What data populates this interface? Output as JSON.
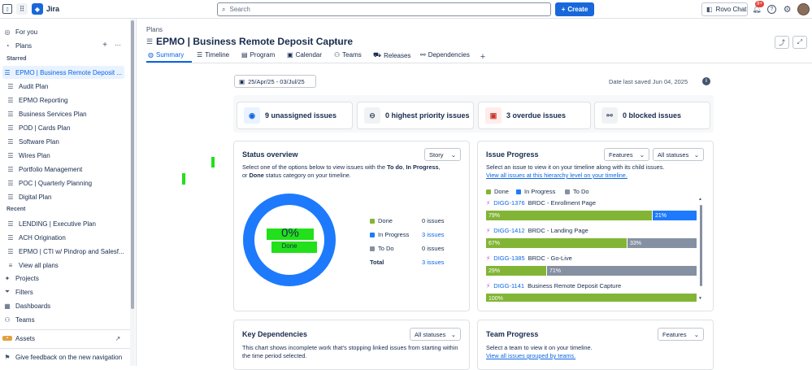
{
  "topbar": {
    "app_name": "Jira",
    "search_placeholder": "Search",
    "create_label": "Create",
    "rovo_label": "Rovo Chat",
    "notif_badge": "9+"
  },
  "sidebar": {
    "for_you": "For you",
    "plans": "Plans",
    "starred_heading": "Starred",
    "recent_heading": "Recent",
    "starred": [
      "EPMO | Business Remote Deposit ...",
      "Audit Plan",
      "EPMO Reporting",
      "Business Services Plan",
      "POD | Cards Plan",
      "Software Plan",
      "Wires Plan",
      "Portfolio Management",
      "POC | Quarterly Planning",
      "Digital Plan"
    ],
    "recent": [
      "LENDING | Executive Plan",
      "ACH Origination",
      "EPMO | CTI w/ Pindrop and Salesf...",
      "View all plans"
    ],
    "bottom": [
      "Projects",
      "Filters",
      "Dashboards",
      "Teams"
    ],
    "assets": "Assets",
    "feedback": "Give feedback on the new navigation"
  },
  "page": {
    "breadcrumb": "Plans",
    "title": "EPMO | Business Remote Deposit Capture",
    "tabs": [
      "Summary",
      "Timeline",
      "Program",
      "Calendar",
      "Teams",
      "Releases",
      "Dependencies"
    ],
    "date_range": "25/Apr/25 - 03/Jul/25",
    "last_saved": "Date last saved Jun 04, 2025"
  },
  "summary_cards": [
    "9 unassigned issues",
    "0 highest priority issues",
    "3 overdue issues",
    "0 blocked issues"
  ],
  "status_overview": {
    "title": "Status overview",
    "dropdown": "Story",
    "desc_1": "Select one of the options below to view issues with the ",
    "desc_todo": "To do",
    "desc_sep1": ", ",
    "desc_inprogress": "In Progress",
    "desc_sep2": ",",
    "desc_2": "or ",
    "desc_done": "Done",
    "desc_3": " status category on your timeline.",
    "donut_pct": "0%",
    "donut_label": "Done",
    "legend": [
      {
        "label": "Done",
        "value": "0 issues"
      },
      {
        "label": "In Progress",
        "value": "3 issues"
      },
      {
        "label": "To Do",
        "value": "0 issues"
      },
      {
        "label": "Total",
        "value": "3 issues"
      }
    ],
    "colors": {
      "done": "#82b536",
      "in_progress": "#1d7afc",
      "todo": "#8590a2"
    }
  },
  "issue_progress": {
    "title": "Issue Progress",
    "dd1": "Features",
    "dd2": "All statuses",
    "desc": "Select an issue to view it on your timeline along with its child issues.",
    "link": "View all issues at this hierarchy level on your timeline.",
    "legend": [
      "Done",
      "In Progress",
      "To Do"
    ],
    "issues": [
      {
        "key": "DIGG-1376",
        "name": "BRDC - Enrollment Page",
        "done": 79,
        "in_progress": 21,
        "todo": 0,
        "done_label": "79%",
        "ip_label": "21%",
        "todo_label": ""
      },
      {
        "key": "DIGG-1412",
        "name": "BRDC - Landing Page",
        "done": 67,
        "in_progress": 0,
        "todo": 33,
        "done_label": "67%",
        "ip_label": "",
        "todo_label": "33%"
      },
      {
        "key": "DIGG-1385",
        "name": "BRDC - Go-Live",
        "done": 29,
        "in_progress": 0,
        "todo": 71,
        "done_label": "29%",
        "ip_label": "",
        "todo_label": "71%"
      },
      {
        "key": "DIGG-1141",
        "name": "Business Remote Deposit Capture",
        "done": 100,
        "in_progress": 0,
        "todo": 0,
        "done_label": "100%",
        "ip_label": "",
        "todo_label": ""
      }
    ]
  },
  "key_dependencies": {
    "title": "Key Dependencies",
    "dropdown": "All statuses",
    "desc": "This chart shows incomplete work that's stopping linked issues from starting within the time period selected."
  },
  "team_progress": {
    "title": "Team Progress",
    "dropdown": "Features",
    "desc": "Select a team to view it on your timeline.",
    "link": "View all issues grouped by teams."
  }
}
